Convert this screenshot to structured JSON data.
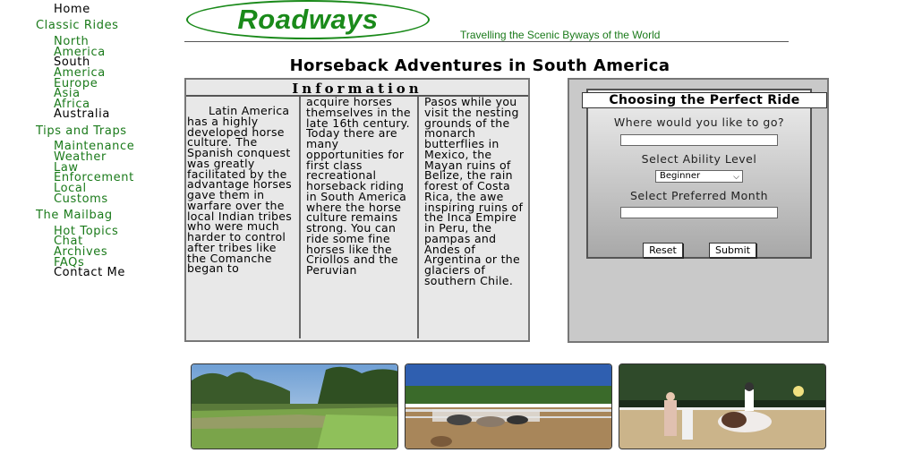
{
  "sidebar": {
    "home": "Home",
    "classic_rides": "Classic Rides",
    "north_america": [
      "North",
      "America"
    ],
    "south_america": [
      "South",
      "America"
    ],
    "europe": "Europe",
    "asia": "Asia",
    "africa": "Africa",
    "australia": "Australia",
    "tips_and_traps": "Tips and Traps",
    "maintenance": "Maintenance",
    "weather": "Weather",
    "law_enforcement": [
      "Law",
      "Enforcement"
    ],
    "local_customs": [
      "Local",
      "Customs"
    ],
    "the_mailbag": "The Mailbag",
    "hot_topics": "Hot Topics",
    "chat": "Chat",
    "archives": "Archives",
    "faqs": "FAQs",
    "contact_me": "Contact Me"
  },
  "header": {
    "logo": "Roadways",
    "tagline": "Travelling the Scenic Byways of the World",
    "page_title": "Horseback Adventures in South America"
  },
  "info": {
    "title": "Information",
    "col1": "Latin America has a highly developed horse culture. The Spanish conquest was greatly facilitated by the advantage horses gave them in warfare over the local Indian tribes who were much harder to control after tribes like the Comanche began to",
    "col2": "acquire horses themselves in the late 16th century. Today there are many opportunities for first class recreational horseback riding in South America where the horse culture remains strong. You can ride some fine horses like the Criollos and the Peruvian",
    "col3": "Pasos while you visit the nesting grounds of the monarch butterflies in Mexico, the Mayan ruins of Belize, the rain forest of Costa Rica, the awe inspiring ruins of the Inca Empire in Peru, the pampas and Andes of Argentina or the glaciers of southern Chile."
  },
  "form": {
    "title": "Choosing the Perfect Ride",
    "where_label": "Where would you like to go?",
    "where_value": "",
    "ability_label": "Select Ability Level",
    "ability_selected": "Beginner",
    "month_label": "Select Preferred Month",
    "month_value": "",
    "reset": "Reset",
    "submit": "Submit"
  },
  "photos": [
    "field-photo",
    "horses-corral-photo",
    "riding-arena-photo"
  ]
}
